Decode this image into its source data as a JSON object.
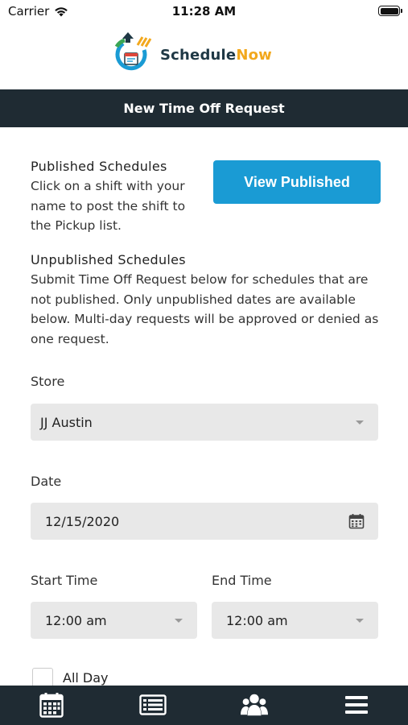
{
  "status_bar": {
    "carrier": "Carrier",
    "time": "11:28 AM"
  },
  "logo": {
    "name_part1": "Schedule",
    "name_part2": "Now"
  },
  "header": {
    "title": "New Time Off Request"
  },
  "published": {
    "title": "Published Schedules",
    "body": "Click on a shift with your name to post the shift to the Pickup list.",
    "button_label": "View Published"
  },
  "unpublished": {
    "title": "Unpublished Schedules",
    "body": "Submit Time Off Request below for schedules that are not published. Only unpublished dates are available below. Multi-day requests will be approved or denied as one request."
  },
  "form": {
    "store_label": "Store",
    "store_value": "JJ Austin",
    "date_label": "Date",
    "date_value": "12/15/2020",
    "start_label": "Start Time",
    "start_value": "12:00 am",
    "end_label": "End Time",
    "end_value": "12:00 am",
    "all_day_label": "All Day"
  },
  "tab_bar": {
    "items": [
      {
        "icon": "calendar-icon"
      },
      {
        "icon": "list-icon"
      },
      {
        "icon": "group-icon"
      },
      {
        "icon": "menu-icon"
      }
    ]
  },
  "colors": {
    "header_bg": "#1f2b33",
    "accent": "#1a9bd4",
    "brand_orange": "#f2a81d",
    "field_bg": "#e8e8e8"
  }
}
